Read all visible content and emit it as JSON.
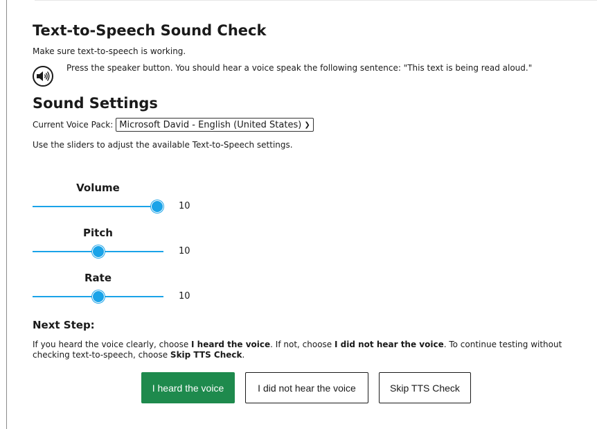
{
  "header": {
    "title": "Text-to-Speech Sound Check",
    "subtitle": "Make sure text-to-speech is working."
  },
  "speaker": {
    "icon": "speaker-icon",
    "instruction": "Press the speaker button. You should hear a voice speak the following sentence: \"This text is being read aloud.\""
  },
  "settings": {
    "heading": "Sound Settings",
    "voice_label": "Current Voice Pack:",
    "voice_selected": "Microsoft David - English (United States)",
    "hint": "Use the sliders to adjust the available Text-to-Speech settings."
  },
  "sliders": {
    "volume": {
      "label": "Volume",
      "value": "10",
      "level": 1.0
    },
    "pitch": {
      "label": "Pitch",
      "value": "10",
      "level": 0.5
    },
    "rate": {
      "label": "Rate",
      "value": "10",
      "level": 0.5
    }
  },
  "next_step": {
    "heading": "Next Step:",
    "text_1": "If you heard the voice clearly, choose ",
    "bold_1": "I heard the voice",
    "text_2": ". If not, choose ",
    "bold_2": "I did not hear the voice",
    "text_3": ". To continue testing without checking text-to-speech, choose ",
    "bold_3": "Skip TTS Check",
    "text_4": "."
  },
  "buttons": {
    "heard": "I heard the voice",
    "not_heard": "I did not hear the voice",
    "skip": "Skip TTS Check"
  },
  "colors": {
    "accent": "#1aa3e8",
    "primary_button": "#1e8a4d"
  }
}
